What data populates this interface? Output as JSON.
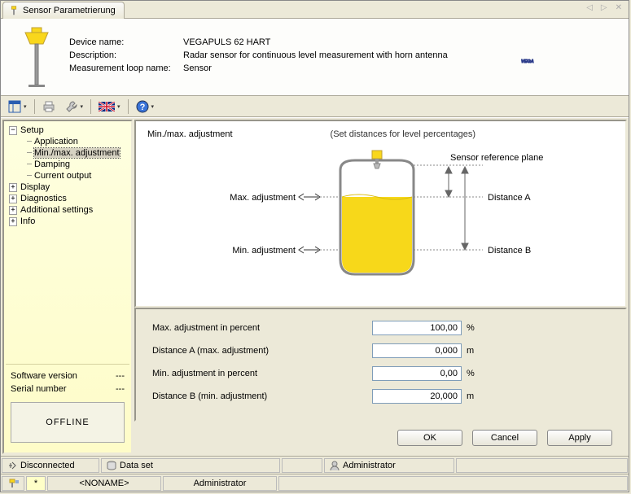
{
  "tab_title": "Sensor Parametrierung",
  "header": {
    "device_name_label": "Device name:",
    "device_name": "VEGAPULS 62 HART",
    "description_label": "Description:",
    "description": "Radar sensor for continuous level measurement with horn antenna",
    "loop_label": "Measurement loop name:",
    "loop": "Sensor"
  },
  "tree": {
    "setup": "Setup",
    "application": "Application",
    "minmax": "Min./max. adjustment",
    "damping": "Damping",
    "current_output": "Current output",
    "display": "Display",
    "diagnostics": "Diagnostics",
    "additional": "Additional settings",
    "info": "Info"
  },
  "sidebar": {
    "software_version_label": "Software version",
    "software_version": "---",
    "serial_number_label": "Serial number",
    "serial_number": "---",
    "offline": "OFFLINE"
  },
  "main": {
    "title": "Min./max. adjustment",
    "subtitle": "(Set distances for level percentages)",
    "sensor_ref": "Sensor reference plane",
    "max_adj": "Max. adjustment",
    "min_adj": "Min. adjustment",
    "dist_a": "Distance A",
    "dist_b": "Distance B"
  },
  "params": {
    "max_pct_label": "Max. adjustment in percent",
    "max_pct": "100,00",
    "dist_a_label": "Distance A (max. adjustment)",
    "dist_a": "0,000",
    "min_pct_label": "Min. adjustment in percent",
    "min_pct": "0,00",
    "dist_b_label": "Distance B (min. adjustment)",
    "dist_b": "20,000",
    "pct": "%",
    "m": "m"
  },
  "buttons": {
    "ok": "OK",
    "cancel": "Cancel",
    "apply": "Apply"
  },
  "status": {
    "disconnected": "Disconnected",
    "dataset": "Data set",
    "admin": "Administrator",
    "noname": "<NONAME>",
    "admin2": "Administrator",
    "star": "*"
  }
}
